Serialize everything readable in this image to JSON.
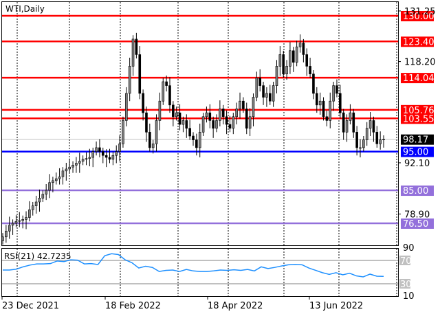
{
  "chart_data": {
    "type": "candlestick",
    "title": "WTI,Daily",
    "symbol": "WTI",
    "timeframe": "Daily",
    "ylim": [
      70.5,
      133.5
    ],
    "y_tick_labels": [
      "131.25",
      "118.20",
      "92.10",
      "78.90"
    ],
    "y_ticks": [
      131.25,
      118.2,
      92.1,
      78.9
    ],
    "x_tick_labels": [
      "23 Dec 2021",
      "18 Feb 2022",
      "18 Apr 2022",
      "13 Jun 2022"
    ],
    "x_tick_bar_index": [
      0,
      30,
      60,
      89
    ],
    "closes": [
      73,
      74.5,
      76,
      76.5,
      77,
      77.2,
      77.5,
      78,
      80,
      81,
      82,
      83,
      84,
      85,
      87,
      87.5,
      88,
      88.5,
      90,
      90.5,
      91,
      91.5,
      92,
      92.5,
      93,
      93.2,
      93.5,
      95,
      96,
      95,
      94,
      93.5,
      93,
      94,
      95,
      97,
      103,
      110,
      117,
      124,
      120,
      110,
      105,
      100,
      96,
      97,
      103,
      108,
      113,
      112,
      107,
      104,
      105,
      102,
      103,
      101,
      99,
      98,
      96,
      100,
      104,
      105,
      103,
      101,
      103,
      106,
      104,
      102,
      101,
      104,
      106,
      108,
      106,
      101,
      104,
      109,
      114,
      112,
      109,
      110,
      108,
      112,
      117,
      120,
      115,
      117,
      121,
      118,
      122,
      123,
      120,
      117,
      115,
      110,
      107,
      108,
      104,
      103,
      108,
      112,
      110,
      105,
      100,
      103,
      105,
      100,
      96,
      96,
      98,
      101,
      103,
      100,
      97,
      98,
      98.17
    ],
    "current_price": {
      "value": 98.17,
      "label": "98.17"
    },
    "levels": [
      {
        "value": 130.0,
        "label": "130.00",
        "color": "#ff0000"
      },
      {
        "value": 123.4,
        "label": "123.40",
        "color": "#ff0000"
      },
      {
        "value": 114.04,
        "label": "114.04",
        "color": "#ff0000"
      },
      {
        "value": 105.76,
        "label": "105.76",
        "color": "#ff0000"
      },
      {
        "value": 103.55,
        "label": "103.55",
        "color": "#ff0000"
      },
      {
        "value": 95.0,
        "label": "95.00",
        "color": "#0000ff"
      },
      {
        "value": 85.0,
        "label": "85.00",
        "color": "#9370db"
      },
      {
        "value": 76.5,
        "label": "76.50",
        "color": "#9370db"
      }
    ],
    "indicator": {
      "label": "RSI(21) 42.7235",
      "name": "RSI(21)",
      "value": 42.7235,
      "ylim": [
        10,
        90
      ],
      "tick_labels": [
        "90",
        "10"
      ],
      "levels": [
        {
          "value": 70,
          "label": "70"
        },
        {
          "value": 30,
          "label": "30"
        }
      ],
      "color": "#1e90ff",
      "values": [
        53.5,
        53.5,
        55,
        59,
        62,
        64,
        64,
        64.5,
        69,
        68,
        71,
        70.5,
        64,
        64.5,
        63,
        78,
        81.5,
        80,
        71,
        66,
        57,
        60,
        58,
        51,
        53,
        53.5,
        51,
        54.5,
        52,
        51,
        51,
        52,
        53.5,
        53,
        54,
        53,
        54.5,
        52,
        59,
        56,
        58,
        60.5,
        62.5,
        63,
        62.5,
        57,
        53,
        49,
        46,
        49,
        45.3,
        48,
        43.5,
        41.8,
        46.5,
        43,
        42.72
      ]
    }
  }
}
